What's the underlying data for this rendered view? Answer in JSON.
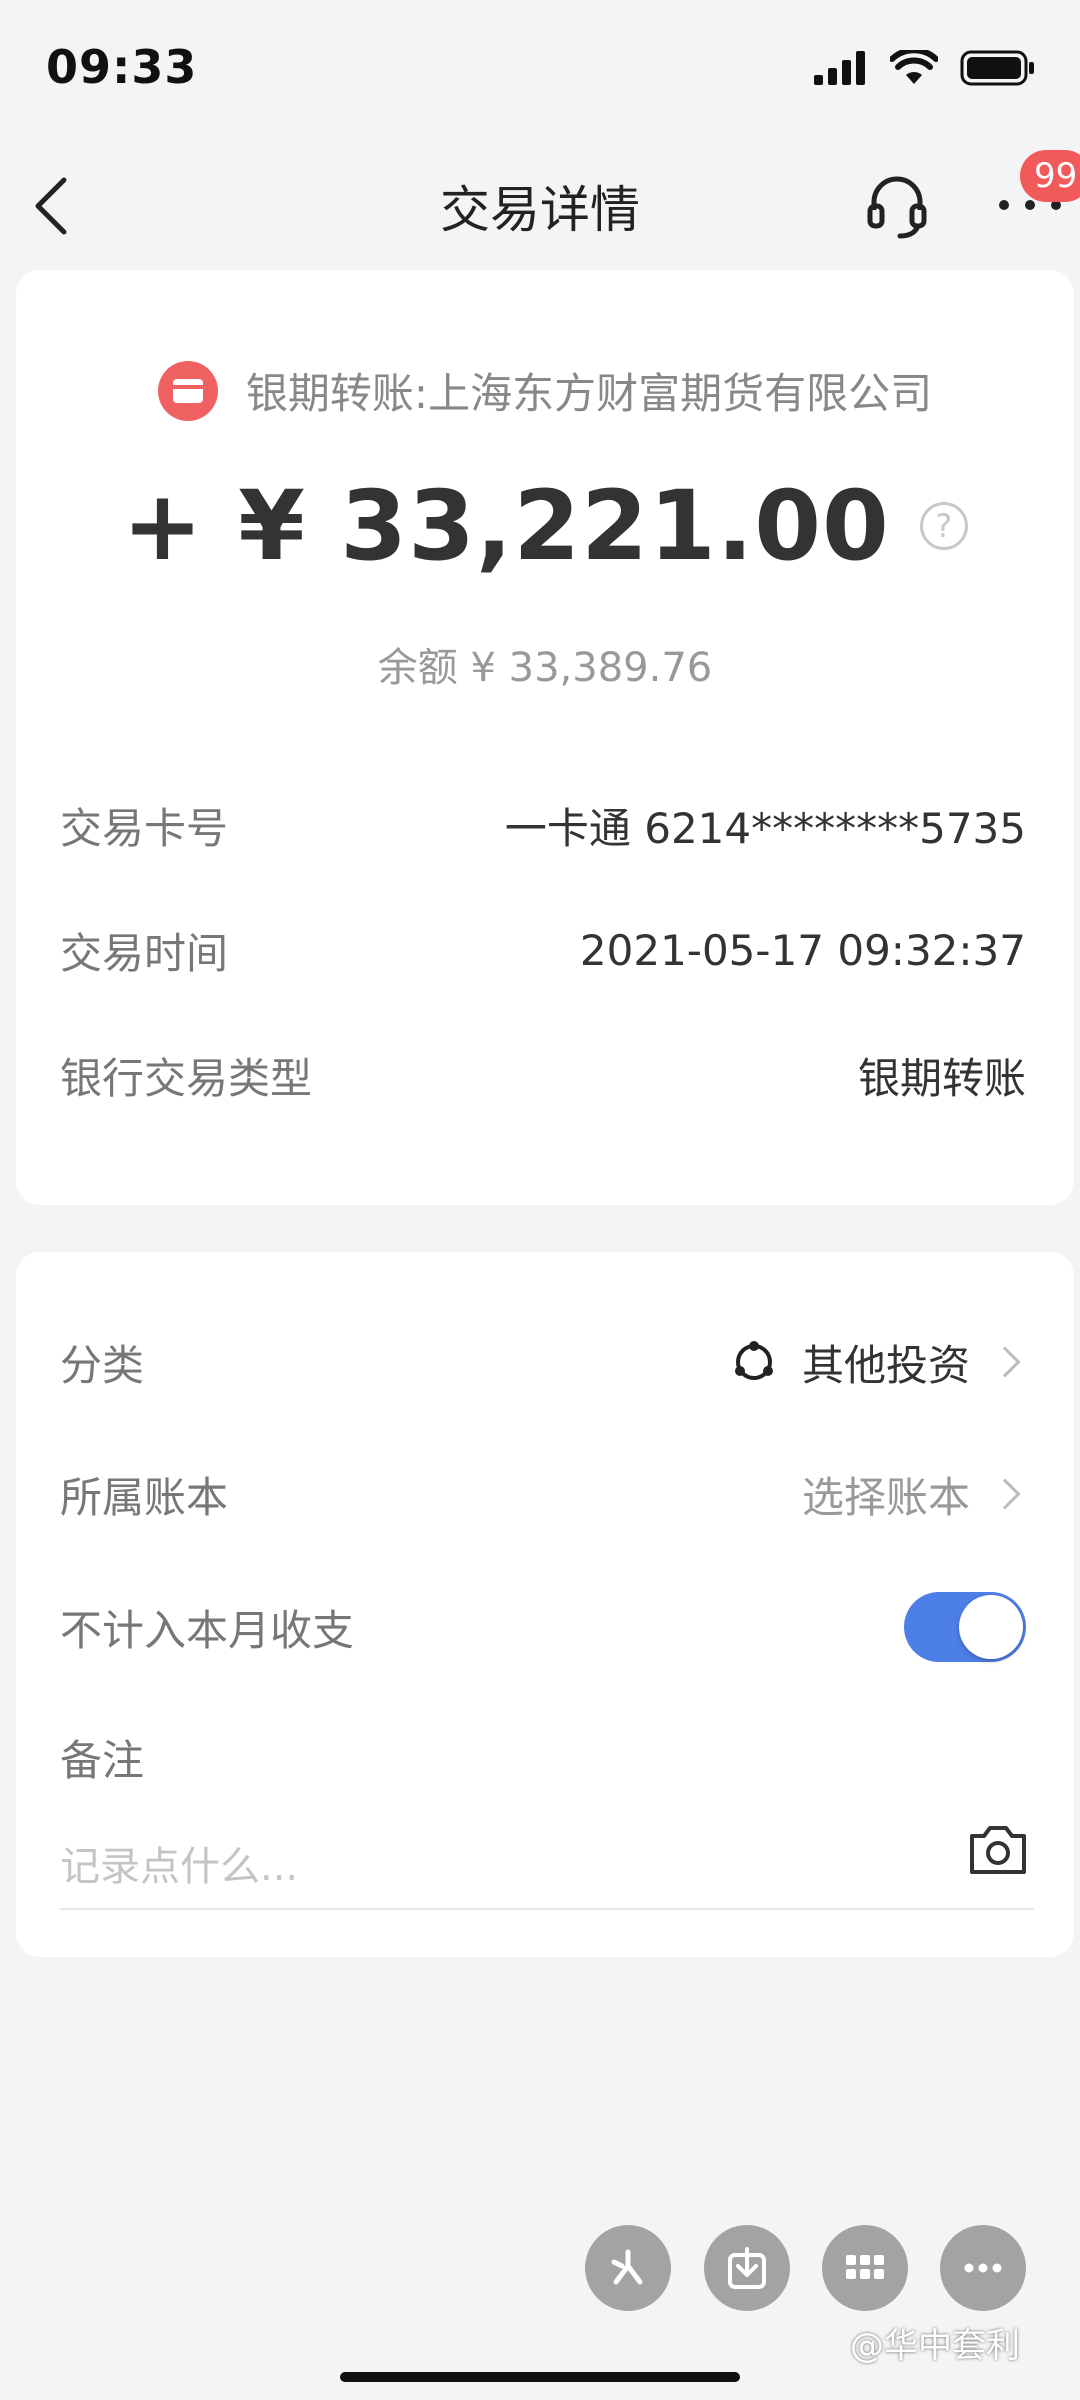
{
  "status_bar": {
    "time": "09:33"
  },
  "nav": {
    "title": "交易详情",
    "badge": "99"
  },
  "summary": {
    "merchant": "银期转账:上海东方财富期货有限公司",
    "amount": "+ ¥ 33,221.00",
    "balance": "余额 ¥ 33,389.76"
  },
  "details": {
    "card_label": "交易卡号",
    "card_value": "一卡通 6214********5735",
    "time_label": "交易时间",
    "time_value": "2021-05-17 09:32:37",
    "type_label": "银行交易类型",
    "type_value": "银期转账"
  },
  "settings": {
    "category_label": "分类",
    "category_value": "其他投资",
    "book_label": "所属账本",
    "book_value": "选择账本",
    "exclude_label": "不计入本月收支",
    "exclude_enabled": true,
    "note_label": "备注",
    "note_placeholder": "记录点什么...",
    "note_value": ""
  },
  "watermark": "@华中套利",
  "colors": {
    "accent": "#4d7fe8",
    "merchant_icon": "#f06262",
    "badge": "#f25a5a",
    "fab": "#a3a3a3"
  },
  "icons": {
    "back": "chevron-left-icon",
    "support": "headset-icon",
    "more": "ellipsis-icon",
    "merchant": "card-icon",
    "help": "question-circle-icon",
    "category": "investment-icon",
    "camera": "camera-icon",
    "fabs": [
      "spark-icon",
      "download-icon",
      "grid-icon",
      "ellipsis-icon"
    ]
  }
}
